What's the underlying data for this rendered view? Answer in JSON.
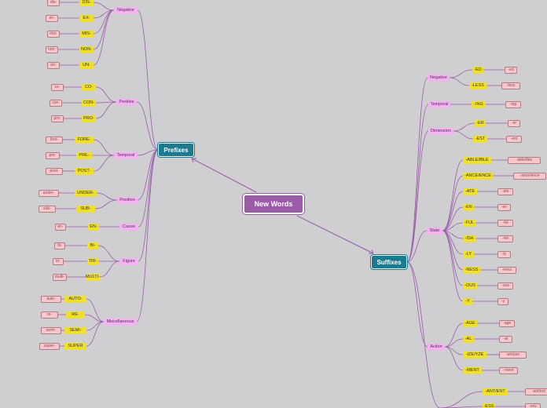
{
  "root": {
    "label": "New Words"
  },
  "prefixes": {
    "label": "Prefixes",
    "groups": [
      {
        "label": "Negative",
        "items": [
          {
            "key": "DIS-",
            "example": "dis-"
          },
          {
            "key": "EX-",
            "example": "ex-"
          },
          {
            "key": "MIS-",
            "example": "mis-"
          },
          {
            "key": "NON-",
            "example": "non-"
          },
          {
            "key": "UN-",
            "example": "un-"
          }
        ]
      },
      {
        "label": "Positive",
        "items": [
          {
            "key": "CO-",
            "example": "co-"
          },
          {
            "key": "CON-",
            "example": "con-"
          },
          {
            "key": "PRO-",
            "example": "pro-"
          }
        ]
      },
      {
        "label": "Temporal",
        "items": [
          {
            "key": "FORE-",
            "example": "fore-"
          },
          {
            "key": "PRE-",
            "example": "pre-"
          },
          {
            "key": "POST-",
            "example": "post-"
          }
        ]
      },
      {
        "label": "Position",
        "items": [
          {
            "key": "UNDER-",
            "example": "under-"
          },
          {
            "key": "SUB-",
            "example": "sub-"
          }
        ]
      },
      {
        "label": "Cause",
        "items": [
          {
            "key": "EN-",
            "example": "en-"
          }
        ]
      },
      {
        "label": "Figure",
        "items": [
          {
            "key": "BI-",
            "example": "bi-"
          },
          {
            "key": "TRI-",
            "example": "tri-"
          },
          {
            "key": "MULTI-",
            "example": "multi-"
          }
        ]
      },
      {
        "label": "Miscellaneous",
        "items": [
          {
            "key": "AUTO-",
            "example": "auto-"
          },
          {
            "key": "RE-",
            "example": "re-"
          },
          {
            "key": "SEMI-",
            "example": "semi-"
          },
          {
            "key": "SUPER",
            "example": "super-"
          }
        ]
      }
    ]
  },
  "suffixes": {
    "label": "Suffixes",
    "groups": [
      {
        "label": "Negative",
        "items": [
          {
            "key": "-ED",
            "example": "-ed"
          },
          {
            "key": "-LESS",
            "example": "-less"
          }
        ]
      },
      {
        "label": "Temporal",
        "items": [
          {
            "key": "-ING",
            "example": "-ing"
          }
        ]
      },
      {
        "label": "Dimension",
        "items": [
          {
            "key": "-ER",
            "example": "-er"
          },
          {
            "key": "-EST",
            "example": "-est"
          }
        ]
      },
      {
        "label": "State",
        "items": [
          {
            "key": "-ABLE/IBLE",
            "example": "-able/ible"
          },
          {
            "key": "-ANCE/ENCE",
            "example": "-ance/ence"
          },
          {
            "key": "-ATE",
            "example": "-ate"
          },
          {
            "key": "-EN",
            "example": "-en"
          },
          {
            "key": "-FUL",
            "example": "-ful"
          },
          {
            "key": "-ISH",
            "example": "-ish"
          },
          {
            "key": "-LY",
            "example": "-ly"
          },
          {
            "key": "-NESS",
            "example": "-ness"
          },
          {
            "key": "-OUS",
            "example": "-ous"
          },
          {
            "key": "-Y",
            "example": "-y"
          }
        ]
      },
      {
        "label": "Action",
        "items": [
          {
            "key": "-AGE",
            "example": "-age"
          },
          {
            "key": "-AL",
            "example": "-al"
          },
          {
            "key": "-IZE/YZE",
            "example": "-ize/yze"
          },
          {
            "key": "-MENT",
            "example": "-ment"
          }
        ]
      },
      {
        "label": "",
        "items": [
          {
            "key": "-ANT/ENT",
            "example": "-ant/ent"
          },
          {
            "key": "-ESS",
            "example": "-ess"
          }
        ]
      }
    ]
  },
  "colors": {
    "background": "#cfcfd1",
    "root": "#9a5ba8",
    "main": "#1a7a91",
    "category": "#f2b3f0",
    "keyword": "#f0e02c",
    "example": "#f6c8cc",
    "link": "#9a5ba8"
  }
}
